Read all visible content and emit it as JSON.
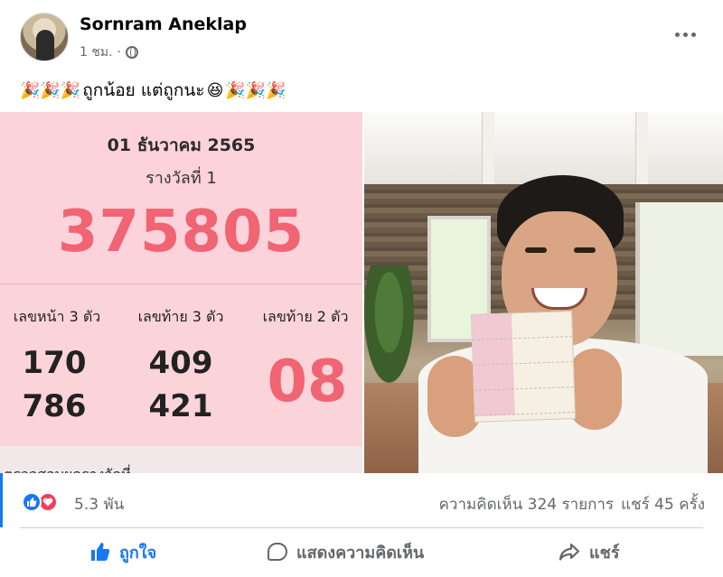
{
  "post": {
    "author": "Sornram Aneklap",
    "time": "1 ชม.",
    "separator": "·",
    "caption_prefix_emoji": "🎉🎉🎉",
    "caption_text": " ถูกน้อย แต่ถูกนะ",
    "caption_laugh_emoji": "😆",
    "caption_suffix_emoji": " 🎉🎉🎉"
  },
  "lottery": {
    "date": "01 ธันวาคม 2565",
    "prize_label": "รางวัลที่ 1",
    "prize_number": "375805",
    "front3_label": "เลขหน้า 3 ตัว",
    "front3_values": [
      "170",
      "786"
    ],
    "back3_label": "เลขท้าย 3 ตัว",
    "back3_values": [
      "409",
      "421"
    ],
    "back2_label": "เลขท้าย 2 ตัว",
    "back2_value": "08",
    "cutoff_text": "ตรวจสอบผลรางวัลที่"
  },
  "reactions": {
    "count": "5.3 พัน",
    "comments": "ความคิดเห็น 324 รายการ",
    "shares": "แชร์ 45 ครั้ง",
    "like_icon": "thumbs-up-icon",
    "love_icon": "heart-icon"
  },
  "actions": {
    "like": "ถูกใจ",
    "comment": "แสดงความคิดเห็น",
    "share": "แชร์"
  },
  "colors": {
    "accent": "#1877f2",
    "lotto_pink": "#fcd3da",
    "lotto_number": "#f06474",
    "love": "#f33e58",
    "muted_text": "#65676b"
  }
}
